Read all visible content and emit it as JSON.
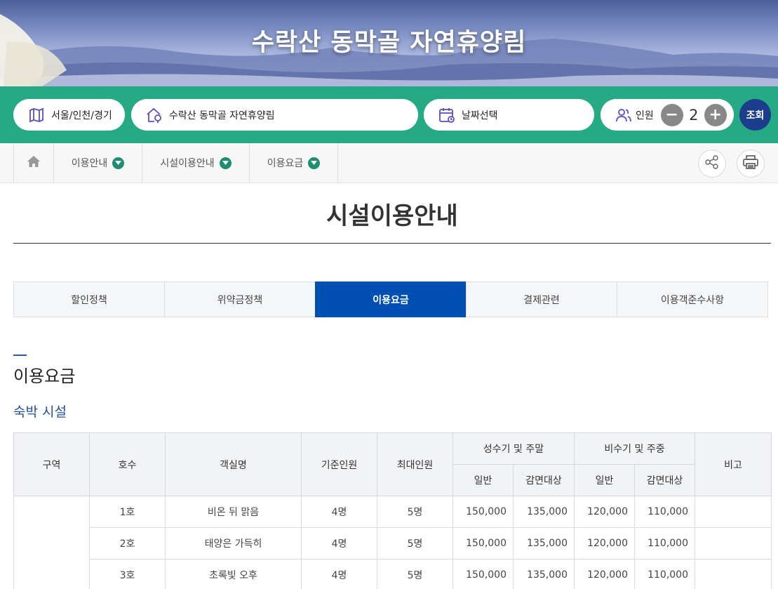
{
  "banner": {
    "title": "수락산 동막골 자연휴양림"
  },
  "search": {
    "region": "서울/인천/경기",
    "forest": "수락산 동막골 자연휴양림",
    "date": "날짜선택",
    "people_label": "인원",
    "people_count": "2",
    "minus": "−",
    "plus": "+",
    "submit": "조회"
  },
  "breadcrumb": {
    "items": [
      "이용안내",
      "시설이용안내",
      "이용요금"
    ]
  },
  "page": {
    "title": "시설이용안내"
  },
  "tabs": [
    "할인정책",
    "위약금정책",
    "이용요금",
    "결제관련",
    "이용객준수사항"
  ],
  "section": {
    "title": "이용요금",
    "subtitle": "숙박 시설"
  },
  "table": {
    "headers": {
      "zone": "구역",
      "room_no": "호수",
      "room_name": "객실명",
      "base": "기준인원",
      "max": "최대인원",
      "peak": "성수기 및 주말",
      "offpeak": "비수기 및 주중",
      "normal": "일반",
      "discount": "감면대상",
      "note": "비고"
    },
    "rows": [
      {
        "zone": "",
        "no": "1호",
        "name": "비온 뒤 맑음",
        "base": "4명",
        "max": "5명",
        "p_normal": "150,000",
        "p_disc": "135,000",
        "o_normal": "120,000",
        "o_disc": "110,000",
        "note": ""
      },
      {
        "zone": "",
        "no": "2호",
        "name": "태양은 가득히",
        "base": "4명",
        "max": "5명",
        "p_normal": "150,000",
        "p_disc": "135,000",
        "o_normal": "120,000",
        "o_disc": "110,000",
        "note": ""
      },
      {
        "zone": "",
        "no": "3호",
        "name": "초록빛 오후",
        "base": "4명",
        "max": "5명",
        "p_normal": "150,000",
        "p_disc": "135,000",
        "o_normal": "120,000",
        "o_disc": "110,000",
        "note": ""
      }
    ]
  },
  "colors": {
    "search_bar": "#25aa85",
    "active_tab": "#0050b4",
    "search_button": "#1b3d8c",
    "subtitle": "#23509e"
  }
}
